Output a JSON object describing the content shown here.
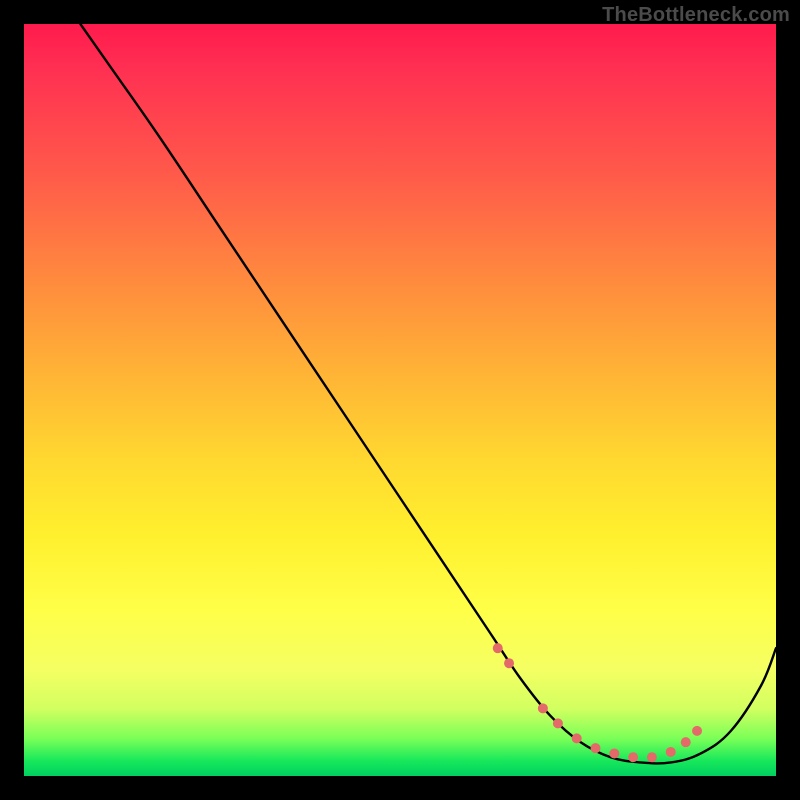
{
  "watermark": "TheBottleneck.com",
  "chart_data": {
    "type": "line",
    "title": "",
    "xlabel": "",
    "ylabel": "",
    "xlim": [
      0,
      100
    ],
    "ylim": [
      0,
      100
    ],
    "grid": false,
    "series": [
      {
        "name": "bottleneck-curve",
        "color": "#000000",
        "x_pct": [
          7.5,
          11,
          18,
          26,
          34,
          42,
          50,
          56,
          62,
          66,
          70,
          74,
          78,
          82,
          86,
          90,
          94,
          98,
          100
        ],
        "y_pct": [
          100,
          95,
          85,
          73,
          61,
          49,
          37,
          28,
          19,
          13,
          8,
          4.5,
          2.5,
          1.8,
          1.8,
          3,
          6,
          12,
          17
        ],
        "notes": "y_pct is the curve height above the plot bottom as a percentage of plot height; x_pct is horizontal position as a percentage of plot width. The curve is a steep descending line from top-left that flattens into a shallow trough around x≈78–86% and rises again toward the right edge."
      },
      {
        "name": "trough-markers",
        "type": "scatter",
        "color": "#e46a6a",
        "x_pct": [
          63,
          64.5,
          69,
          71,
          73.5,
          76,
          78.5,
          81,
          83.5,
          86,
          88,
          89.5
        ],
        "y_pct": [
          17,
          15,
          9,
          7,
          5,
          3.7,
          3.0,
          2.5,
          2.5,
          3.2,
          4.5,
          6
        ]
      }
    ]
  }
}
